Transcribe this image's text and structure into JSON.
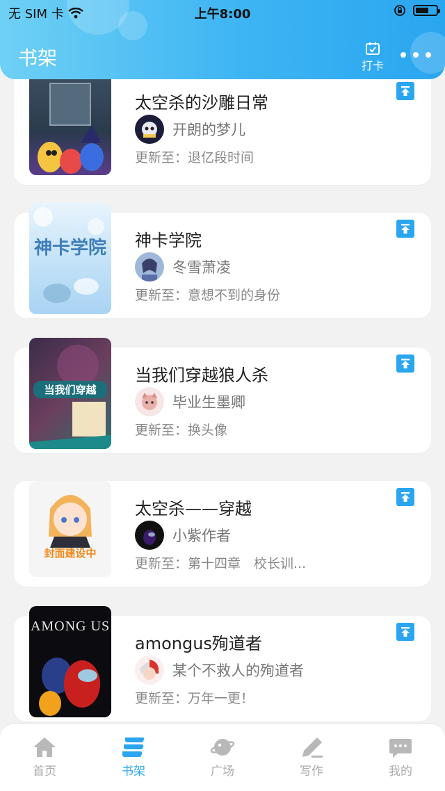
{
  "status_bar": {
    "carrier": "无 SIM 卡",
    "time": "上午8:00"
  },
  "header": {
    "title": "书架",
    "checkin_label": "打卡"
  },
  "books": [
    {
      "title": "太空杀的沙雕日常",
      "author": "开朗的梦儿",
      "update_prefix": "更新至：",
      "update_text": "退亿段时间",
      "cover_caption": ""
    },
    {
      "title": "神卡学院",
      "author": "冬雪萧凌",
      "update_prefix": "更新至：",
      "update_text": "意想不到的身份",
      "cover_caption": "神卡学院"
    },
    {
      "title": "当我们穿越狼人杀",
      "author": "毕业生墨卿",
      "update_prefix": "更新至：",
      "update_text": "换头像",
      "cover_caption": "当我们穿越"
    },
    {
      "title": "太空杀——穿越",
      "author": "小紫作者",
      "update_prefix": "更新至：",
      "update_text": "第十四章　校长训...",
      "cover_caption": "封面建设中"
    },
    {
      "title": "amongus殉道者",
      "author": "某个不救人的殉道者",
      "update_prefix": "更新至：",
      "update_text": "万年一更！",
      "cover_caption": "AMONG US"
    }
  ],
  "tabbar": {
    "items": [
      {
        "label": "首页",
        "icon": "home-icon",
        "active": false
      },
      {
        "label": "书架",
        "icon": "bookshelf-icon",
        "active": true
      },
      {
        "label": "广场",
        "icon": "planet-icon",
        "active": false
      },
      {
        "label": "写作",
        "icon": "pen-icon",
        "active": false
      },
      {
        "label": "我的",
        "icon": "chat-bubble-icon",
        "active": false
      }
    ]
  },
  "colors": {
    "accent": "#2aa6f0",
    "background": "#f2f2f2",
    "inactive_tab": "#aaaaaa"
  }
}
